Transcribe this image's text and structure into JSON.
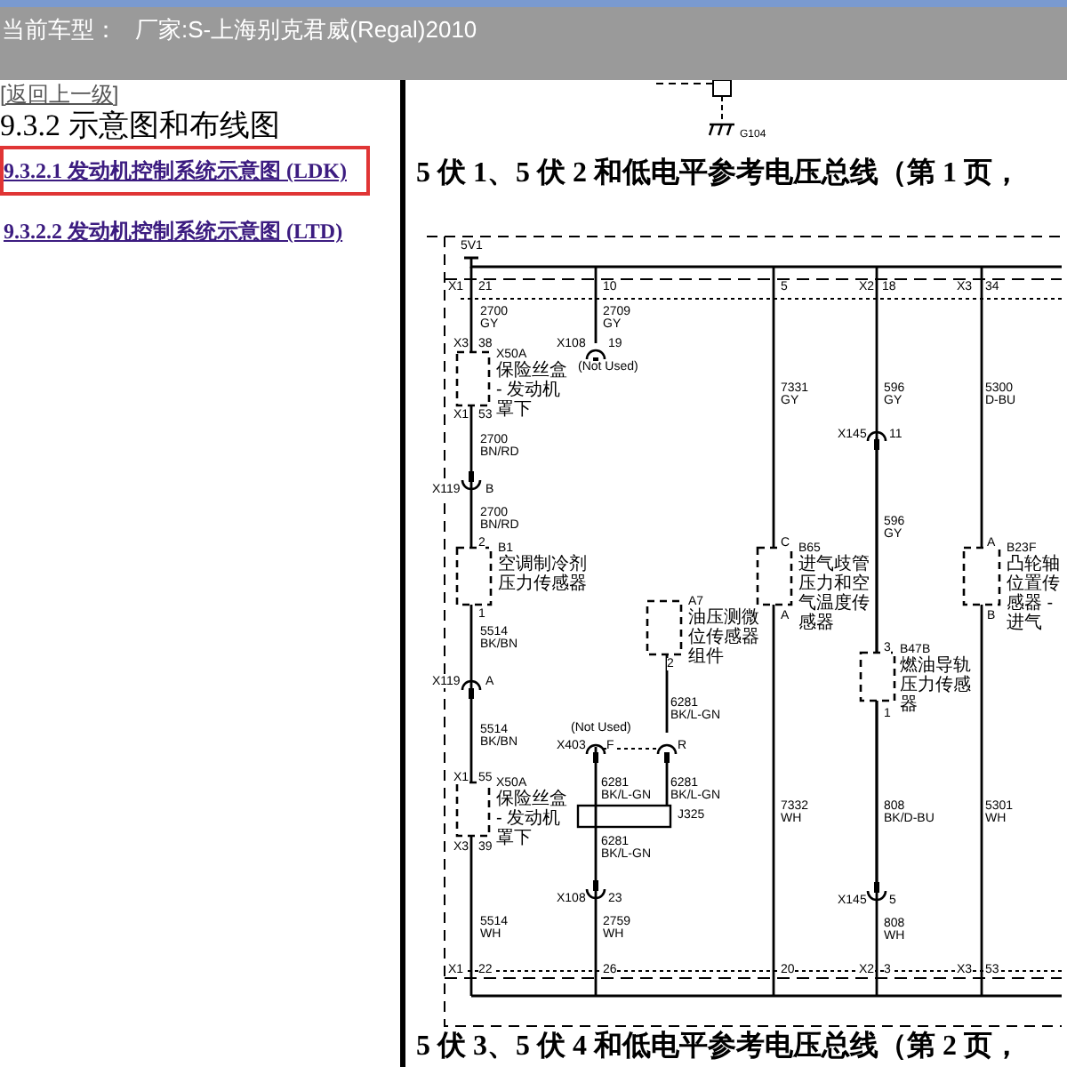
{
  "header": {
    "label": "当前车型：",
    "value": "厂家:S-上海别克君威(Regal)2010"
  },
  "nav": {
    "back_link": "[返回上一级]",
    "title": "9.3.2 示意图和布线图",
    "links": [
      {
        "text": "9.3.2.1 发动机控制系统示意图 (LDK)",
        "selected": true
      },
      {
        "text": "9.3.2.2 发动机控制系统示意图 (LTD)",
        "selected": false
      }
    ]
  },
  "diagram": {
    "ground_label": "G104",
    "headings": [
      "5 伏 1、5 伏 2 和低电平参考电压总线（第 1 页，",
      "5 伏 3、5 伏 4 和低电平参考电压总线（第 2 页，"
    ],
    "labels": [
      "5V1",
      "X1",
      "21",
      "10",
      "5",
      "X2",
      "18",
      "X3",
      "34",
      "2700",
      "GY",
      "2709",
      "GY",
      "X3",
      "38",
      "X108",
      "19",
      "(Not Used)",
      "X1",
      "53",
      "2700",
      "BN/RD",
      "X119",
      "B",
      "2700",
      "BN/RD",
      "2",
      "1",
      "5514",
      "BK/BN",
      "X119",
      "A",
      "5514",
      "BK/BN",
      "X1",
      "55",
      "X3",
      "39",
      "5514",
      "WH",
      "X1",
      "22",
      "2",
      "6281",
      "BK/L-GN",
      "(Not Used)",
      "X403",
      "F",
      "R",
      "6281",
      "BK/L-GN",
      "6281",
      "BK/L-GN",
      "J325",
      "6281",
      "BK/L-GN",
      "X108",
      "23",
      "2759",
      "WH",
      "26",
      "7331",
      "GY",
      "C",
      "A",
      "7332",
      "WH",
      "20",
      "596",
      "GY",
      "X145",
      "11",
      "596",
      "GY",
      "3",
      "1",
      "808",
      "BK/D-BU",
      "X145",
      "5",
      "808",
      "WH",
      "X2",
      "3",
      "5300",
      "D-BU",
      "A",
      "B",
      "5301",
      "WH",
      "X3",
      "53"
    ],
    "components": [
      {
        "ref": "X50A",
        "desc": "保险丝盒 - 发动机罩下"
      },
      {
        "ref": "B1",
        "desc": "空调制冷剂压力传感器"
      },
      {
        "ref": "A7",
        "desc": "油压测微位传感器组件"
      },
      {
        "ref": "X50A",
        "desc": "保险丝盒 - 发动机罩下"
      },
      {
        "ref": "B65",
        "desc": "进气歧管压力和空气温度传感器"
      },
      {
        "ref": "B47B",
        "desc": "燃油导轨压力传感器"
      },
      {
        "ref": "B23F",
        "desc": "凸轮轴位置传感器 - 进气"
      }
    ]
  }
}
